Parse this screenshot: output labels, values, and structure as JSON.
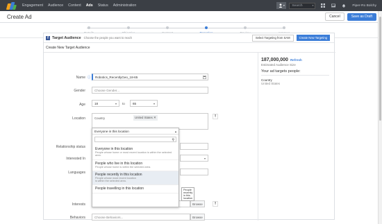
{
  "nav": {
    "items": [
      "Engagement",
      "Audience",
      "Content",
      "Ads",
      "Status",
      "Administration"
    ],
    "active": "Ads",
    "search_placeholder": "Search",
    "user_name": "Piper-Ro Bolchy"
  },
  "header": {
    "title": "Create Ad",
    "cancel_label": "Cancel",
    "save_label": "Save as Draft"
  },
  "steps": [
    "Details",
    "Objective",
    "Content",
    "Targeting",
    "Review",
    "Approve"
  ],
  "active_step": "Targeting",
  "card": {
    "title": "Target Audience",
    "subtitle": "Choose the people you want to reach",
    "select_sam_label": "Select Targeting from SAM",
    "create_new_label": "Create New Targeting",
    "section_title": "Create New Target Audience"
  },
  "form": {
    "name_label": "Name",
    "name_value": "Robotics_RecentlyGeo_18-65",
    "gender_label": "Gender",
    "gender_placeholder": "Choose Gender...",
    "age_label": "Age",
    "age_from": "18",
    "age_to_label": "to",
    "age_to": "65",
    "location_label": "Location",
    "location_type": "Country",
    "location_value": "United States",
    "relationship_label": "Relationship status",
    "interested_label": "Interested In",
    "languages_label": "Languages",
    "interests_label": "Interests",
    "behaviors_label": "Behaviors",
    "behaviors_placeholder": "Choose Behaviors...",
    "browse_label": "Browse"
  },
  "location_dropdown": {
    "selected": "Everyone in this location",
    "options": [
      {
        "title": "Everyone in this location",
        "desc": "People whose home or most recent location is within the selected area."
      },
      {
        "title": "People who live in this location",
        "desc": "People whose home is within the selected area."
      },
      {
        "title": "People recently in this location",
        "desc": "People whose most recent location is within the selected area."
      },
      {
        "title": "People travelling in this location",
        "desc": ""
      }
    ],
    "tooltip": "People recently in this location"
  },
  "audience": {
    "count": "187,000,000",
    "refresh_label": "Refresh",
    "estimated_label": "Estimated Audience Size",
    "targets_title": "Your ad targets people:",
    "country_label": "Country",
    "country_value": "United States"
  }
}
